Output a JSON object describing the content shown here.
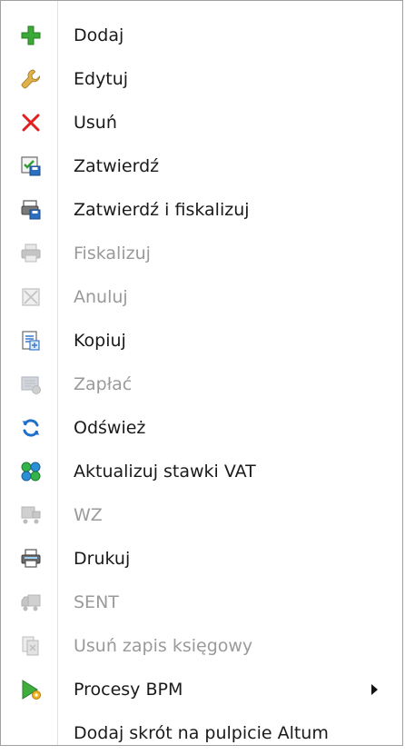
{
  "menu": {
    "items": [
      {
        "label": "Dodaj",
        "icon": "plus-icon",
        "enabled": true
      },
      {
        "label": "Edytuj",
        "icon": "wrench-icon",
        "enabled": true
      },
      {
        "label": "Usuń",
        "icon": "delete-x-icon",
        "enabled": true
      },
      {
        "label": "Zatwierdź",
        "icon": "approve-save-icon",
        "enabled": true
      },
      {
        "label": "Zatwierdź i fiskalizuj",
        "icon": "approve-fiscal-icon",
        "enabled": true
      },
      {
        "label": "Fiskalizuj",
        "icon": "printer-icon",
        "enabled": false
      },
      {
        "label": "Anuluj",
        "icon": "cancel-box-icon",
        "enabled": false
      },
      {
        "label": "Kopiuj",
        "icon": "copy-document-icon",
        "enabled": true
      },
      {
        "label": "Zapłać",
        "icon": "payment-icon",
        "enabled": false
      },
      {
        "label": "Odśwież",
        "icon": "refresh-icon",
        "enabled": true
      },
      {
        "label": "Aktualizuj stawki VAT",
        "icon": "vat-update-icon",
        "enabled": true
      },
      {
        "label": "WZ",
        "icon": "warehouse-issue-icon",
        "enabled": false
      },
      {
        "label": "Drukuj",
        "icon": "printer-icon",
        "enabled": true
      },
      {
        "label": "SENT",
        "icon": "truck-icon",
        "enabled": false
      },
      {
        "label": "Usuń zapis księgowy",
        "icon": "remove-entry-icon",
        "enabled": false
      },
      {
        "label": "Procesy BPM",
        "icon": "bpm-play-icon",
        "enabled": true,
        "submenu": true
      },
      {
        "label": "Dodaj skrót na pulpicie Altum",
        "icon": "",
        "enabled": true
      }
    ]
  },
  "colors": {
    "enabled_text": "#1a1a1a",
    "disabled_text": "#9a9a9a",
    "border": "#a0a0a0",
    "accent_green": "#3aa935",
    "accent_red": "#e02020",
    "accent_blue": "#1e6fc8"
  }
}
